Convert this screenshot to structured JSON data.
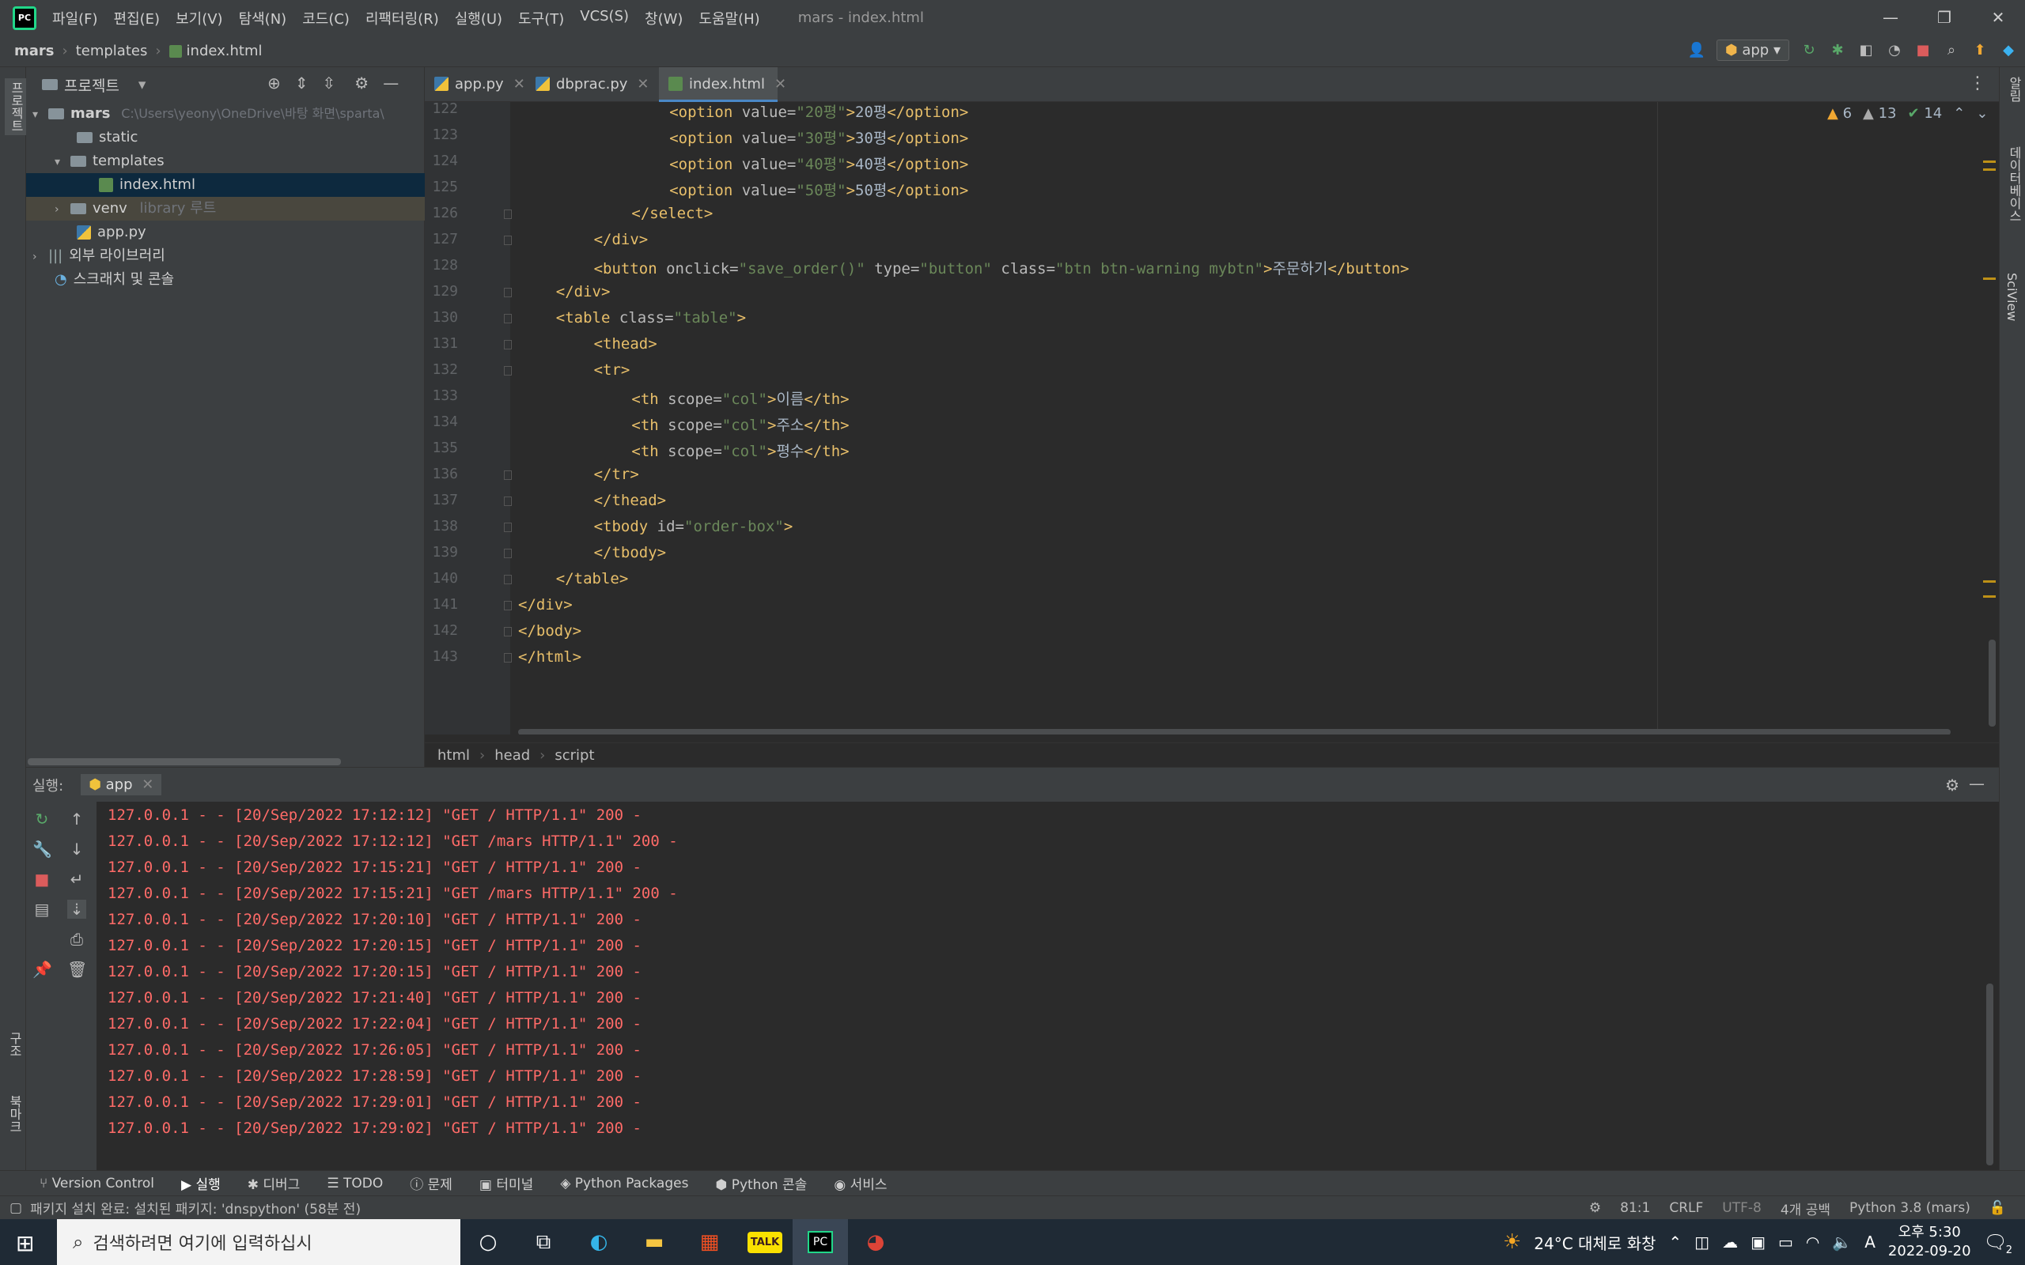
{
  "menubar": {
    "items": [
      "파일(F)",
      "편집(E)",
      "보기(V)",
      "탐색(N)",
      "코드(C)",
      "리팩터링(R)",
      "실행(U)",
      "도구(T)",
      "VCS(S)",
      "창(W)",
      "도움말(H)"
    ],
    "window_title": "mars - index.html"
  },
  "navbar": {
    "crumbs": [
      "mars",
      "templates",
      "index.html"
    ],
    "run_config": "app"
  },
  "project": {
    "title": "프로젝트",
    "root_name": "mars",
    "root_path": "C:\\Users\\yeony\\OneDrive\\바탕 화면\\sparta\\",
    "static": "static",
    "templates": "templates",
    "index_file": "index.html",
    "venv": "venv",
    "venv_note": "library 루트",
    "app_file": "app.py",
    "external_libs": "외부 라이브러리",
    "scratches": "스크래치 및 콘솔"
  },
  "side_labels": {
    "left_top": "프로젝트",
    "left_structure": "구조",
    "left_bookmarks": "북마크",
    "right_notifications": "알림",
    "right_database": "데이터베이스",
    "right_sciview": "SciView"
  },
  "tabs": [
    "app.py",
    "dbprac.py",
    "index.html"
  ],
  "inspections": {
    "warnings": "6",
    "weak_warnings": "13",
    "ok": "14"
  },
  "code_lines": [
    {
      "n": "122",
      "indent": 16,
      "parts": [
        [
          "tag",
          "<option "
        ],
        [
          "attr",
          "value="
        ],
        [
          "val",
          "\"20평\""
        ],
        [
          "tag",
          ">"
        ],
        [
          "txt",
          "20평"
        ],
        [
          "tag",
          "</option>"
        ]
      ]
    },
    {
      "n": "123",
      "indent": 16,
      "parts": [
        [
          "tag",
          "<option "
        ],
        [
          "attr",
          "value="
        ],
        [
          "val",
          "\"30평\""
        ],
        [
          "tag",
          ">"
        ],
        [
          "txt",
          "30평"
        ],
        [
          "tag",
          "</option>"
        ]
      ]
    },
    {
      "n": "124",
      "indent": 16,
      "parts": [
        [
          "tag",
          "<option "
        ],
        [
          "attr",
          "value="
        ],
        [
          "val",
          "\"40평\""
        ],
        [
          "tag",
          ">"
        ],
        [
          "txt",
          "40평"
        ],
        [
          "tag",
          "</option>"
        ]
      ]
    },
    {
      "n": "125",
      "indent": 16,
      "parts": [
        [
          "tag",
          "<option "
        ],
        [
          "attr",
          "value="
        ],
        [
          "val",
          "\"50평\""
        ],
        [
          "tag",
          ">"
        ],
        [
          "txt",
          "50평"
        ],
        [
          "tag",
          "</option>"
        ]
      ]
    },
    {
      "n": "126",
      "indent": 12,
      "parts": [
        [
          "tag",
          "</select>"
        ]
      ]
    },
    {
      "n": "127",
      "indent": 8,
      "parts": [
        [
          "tag",
          "</div>"
        ]
      ]
    },
    {
      "n": "128",
      "indent": 8,
      "parts": [
        [
          "tag",
          "<button "
        ],
        [
          "attr",
          "onclick="
        ],
        [
          "val",
          "\"save_order()\""
        ],
        [
          "attr",
          " type="
        ],
        [
          "val",
          "\"button\""
        ],
        [
          "attr",
          " class="
        ],
        [
          "val",
          "\"btn btn-warning mybtn\""
        ],
        [
          "tag",
          ">"
        ],
        [
          "txt",
          "주문하기"
        ],
        [
          "tag",
          "</button>"
        ]
      ]
    },
    {
      "n": "129",
      "indent": 4,
      "parts": [
        [
          "tag",
          "</div>"
        ]
      ]
    },
    {
      "n": "130",
      "indent": 4,
      "parts": [
        [
          "tag",
          "<table "
        ],
        [
          "attr",
          "class="
        ],
        [
          "val",
          "\"table\""
        ],
        [
          "tag",
          ">"
        ]
      ]
    },
    {
      "n": "131",
      "indent": 8,
      "parts": [
        [
          "tag",
          "<thead>"
        ]
      ]
    },
    {
      "n": "132",
      "indent": 8,
      "parts": [
        [
          "tag",
          "<tr>"
        ]
      ]
    },
    {
      "n": "133",
      "indent": 12,
      "parts": [
        [
          "tag",
          "<th "
        ],
        [
          "attr",
          "scope="
        ],
        [
          "val",
          "\"col\""
        ],
        [
          "tag",
          ">"
        ],
        [
          "txt",
          "이름"
        ],
        [
          "tag",
          "</th>"
        ]
      ]
    },
    {
      "n": "134",
      "indent": 12,
      "parts": [
        [
          "tag",
          "<th "
        ],
        [
          "attr",
          "scope="
        ],
        [
          "val",
          "\"col\""
        ],
        [
          "tag",
          ">"
        ],
        [
          "txt",
          "주소"
        ],
        [
          "tag",
          "</th>"
        ]
      ]
    },
    {
      "n": "135",
      "indent": 12,
      "parts": [
        [
          "tag",
          "<th "
        ],
        [
          "attr",
          "scope="
        ],
        [
          "val",
          "\"col\""
        ],
        [
          "tag",
          ">"
        ],
        [
          "txt",
          "평수"
        ],
        [
          "tag",
          "</th>"
        ]
      ]
    },
    {
      "n": "136",
      "indent": 8,
      "parts": [
        [
          "tag",
          "</tr>"
        ]
      ]
    },
    {
      "n": "137",
      "indent": 8,
      "parts": [
        [
          "tag",
          "</thead>"
        ]
      ]
    },
    {
      "n": "138",
      "indent": 8,
      "parts": [
        [
          "tag",
          "<tbody "
        ],
        [
          "attr",
          "id="
        ],
        [
          "val",
          "\"order-box\""
        ],
        [
          "tag",
          ">"
        ]
      ]
    },
    {
      "n": "139",
      "indent": 8,
      "parts": [
        [
          "tag",
          "</tbody>"
        ]
      ]
    },
    {
      "n": "140",
      "indent": 4,
      "parts": [
        [
          "tag",
          "</table>"
        ]
      ]
    },
    {
      "n": "141",
      "indent": 0,
      "parts": [
        [
          "tag",
          "</div>"
        ]
      ]
    },
    {
      "n": "142",
      "indent": 0,
      "parts": [
        [
          "tag",
          "</body>"
        ]
      ]
    },
    {
      "n": "143",
      "indent": 0,
      "parts": [
        [
          "tag",
          "</html>"
        ]
      ]
    }
  ],
  "editor_breadcrumb": [
    "html",
    "head",
    "script"
  ],
  "run_panel": {
    "label": "실행:",
    "tab": "app",
    "lines": [
      "127.0.0.1 - - [20/Sep/2022 17:12:12] \"GET / HTTP/1.1\" 200 -",
      "127.0.0.1 - - [20/Sep/2022 17:12:12] \"GET /mars HTTP/1.1\" 200 -",
      "127.0.0.1 - - [20/Sep/2022 17:15:21] \"GET / HTTP/1.1\" 200 -",
      "127.0.0.1 - - [20/Sep/2022 17:15:21] \"GET /mars HTTP/1.1\" 200 -",
      "127.0.0.1 - - [20/Sep/2022 17:20:10] \"GET / HTTP/1.1\" 200 -",
      "127.0.0.1 - - [20/Sep/2022 17:20:15] \"GET / HTTP/1.1\" 200 -",
      "127.0.0.1 - - [20/Sep/2022 17:20:15] \"GET / HTTP/1.1\" 200 -",
      "127.0.0.1 - - [20/Sep/2022 17:21:40] \"GET / HTTP/1.1\" 200 -",
      "127.0.0.1 - - [20/Sep/2022 17:22:04] \"GET / HTTP/1.1\" 200 -",
      "127.0.0.1 - - [20/Sep/2022 17:26:05] \"GET / HTTP/1.1\" 200 -",
      "127.0.0.1 - - [20/Sep/2022 17:28:59] \"GET / HTTP/1.1\" 200 -",
      "127.0.0.1 - - [20/Sep/2022 17:29:01] \"GET / HTTP/1.1\" 200 -",
      "127.0.0.1 - - [20/Sep/2022 17:29:02] \"GET / HTTP/1.1\" 200 -"
    ]
  },
  "tool_tabs": [
    "Version Control",
    "실행",
    "디버그",
    "TODO",
    "문제",
    "터미널",
    "Python Packages",
    "Python 콘솔",
    "서비스"
  ],
  "statusbar": {
    "message": "패키지 설치 완료: 설치된 패키지: 'dnspython' (58분 전)",
    "position": "81:1",
    "line_sep": "CRLF",
    "encoding": "UTF-8",
    "indent": "4개 공백",
    "interpreter": "Python 3.8 (mars)"
  },
  "taskbar": {
    "search_placeholder": "검색하려면 여기에 입력하십시",
    "weather": "24°C  대체로 화창",
    "ime": "A",
    "time": "오후 5:30",
    "date": "2022-09-20",
    "notif_count": "2"
  },
  "colors": {
    "tag": "#e8bf6a",
    "value": "#6a8759",
    "console_text": "#ff6b68",
    "selection": "#0d293e"
  }
}
